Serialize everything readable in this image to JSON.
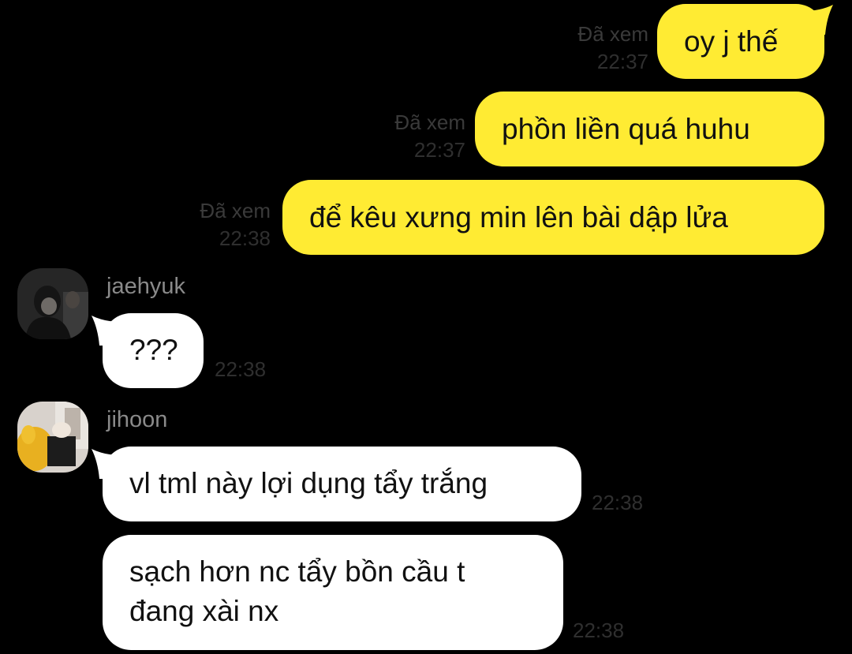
{
  "colors": {
    "background": "#000000",
    "outgoing_bubble": "#FFEB33",
    "incoming_bubble": "#FFFFFF",
    "meta_text": "#2f2f2f",
    "sender_name": "#8a8a8a"
  },
  "outgoing": [
    {
      "text": "oy j thế",
      "read": "Đã xem",
      "time": "22:37"
    },
    {
      "text": "phồn liền quá huhu",
      "read": "Đã xem",
      "time": "22:37"
    },
    {
      "text": "để kêu xưng min lên bài dập lửa",
      "read": "Đã xem",
      "time": "22:38"
    }
  ],
  "incoming": [
    {
      "sender": "jaehyuk",
      "avatar_icon": "profile-photo-icon",
      "messages": [
        {
          "text": "???",
          "time": "22:38"
        }
      ]
    },
    {
      "sender": "jihoon",
      "avatar_icon": "profile-photo-icon",
      "messages": [
        {
          "text": "vl tml này lợi dụng tẩy trắng",
          "time": "22:38"
        },
        {
          "text_lines": [
            "sạch hơn nc tẩy bồn cầu t",
            "đang xài nx"
          ],
          "time": "22:38"
        }
      ]
    }
  ]
}
